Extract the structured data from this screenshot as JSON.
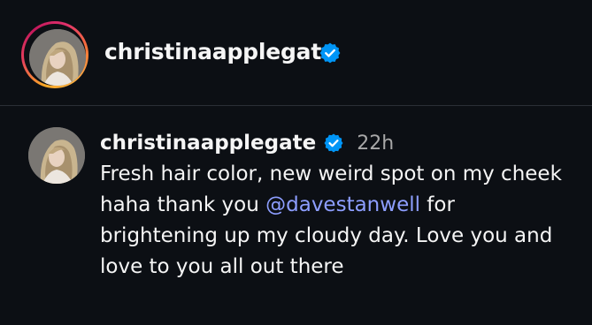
{
  "header": {
    "username": "christinaapplegate",
    "verified_icon": "verified-badge-icon",
    "story_ring_colors": [
      "#fcaf45",
      "#e1306c",
      "#c2185b"
    ]
  },
  "post": {
    "username": "christinaapplegate",
    "timestamp": "22h",
    "caption": {
      "before": "Fresh hair color, new weird spot on my cheek haha thank you ",
      "mention": "@davestanwell",
      "after": " for brightening up my cloudy day. Love you and love to you all out there"
    }
  },
  "colors": {
    "background": "#0c0f14",
    "verified": "#0095f6",
    "mention": "#8d9eff",
    "timestamp": "#a8a8a8"
  }
}
